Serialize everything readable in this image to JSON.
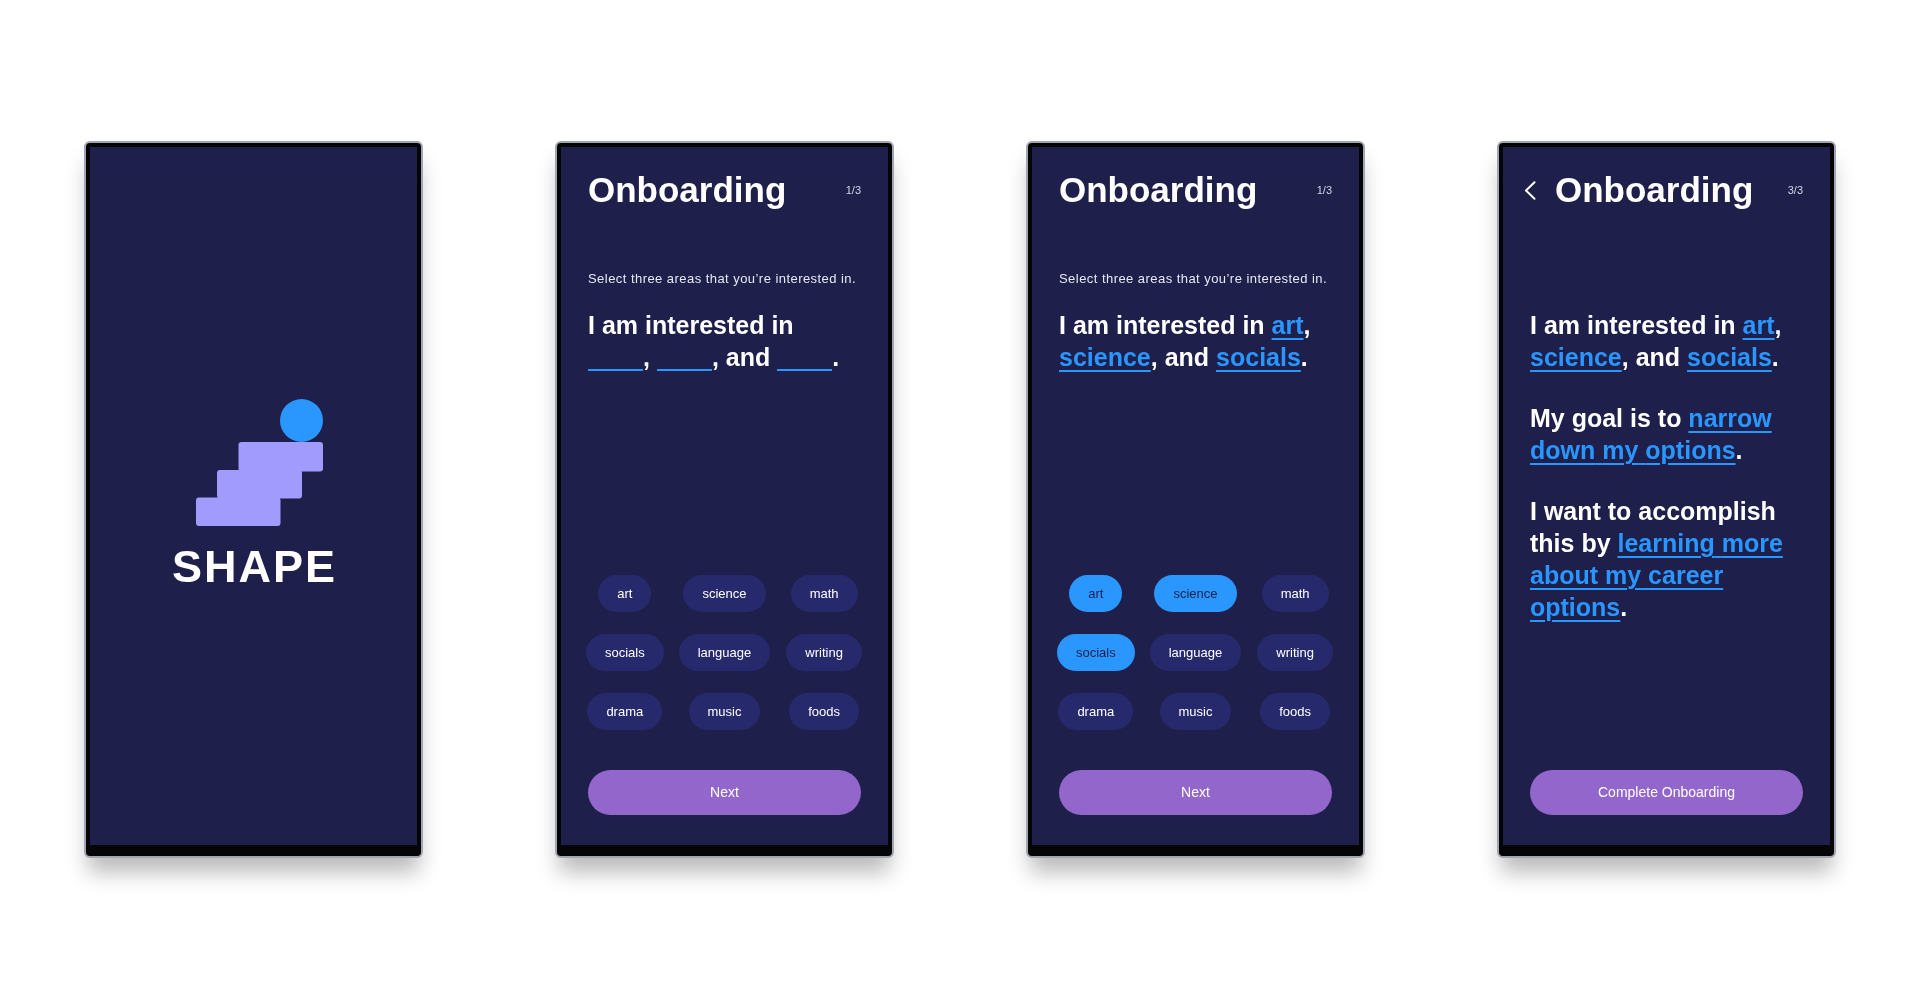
{
  "screens": [
    {
      "kind": "splash",
      "logo_text": "SHAPE"
    },
    {
      "kind": "onboarding",
      "back_button": false,
      "title": "Onboarding",
      "step": "1/3",
      "instruction": "Select three areas that you’re interested in.",
      "statements": [
        {
          "parts": [
            {
              "kind": "text",
              "text": "I am interested in "
            },
            {
              "kind": "blank"
            },
            {
              "kind": "text",
              "text": ", "
            },
            {
              "kind": "blank"
            },
            {
              "kind": "text",
              "text": ", and "
            },
            {
              "kind": "blank"
            },
            {
              "kind": "text",
              "text": "."
            }
          ]
        }
      ],
      "chips": [
        {
          "label": "art",
          "selected": false
        },
        {
          "label": "science",
          "selected": false
        },
        {
          "label": "math",
          "selected": false
        },
        {
          "label": "socials",
          "selected": false
        },
        {
          "label": "language",
          "selected": false
        },
        {
          "label": "writing",
          "selected": false
        },
        {
          "label": "drama",
          "selected": false
        },
        {
          "label": "music",
          "selected": false
        },
        {
          "label": "foods",
          "selected": false
        }
      ],
      "button": "Next"
    },
    {
      "kind": "onboarding",
      "back_button": false,
      "title": "Onboarding",
      "step": "1/3",
      "instruction": "Select three areas that you’re interested in.",
      "statements": [
        {
          "parts": [
            {
              "kind": "text",
              "text": "I am interested in "
            },
            {
              "kind": "answer",
              "text": "art"
            },
            {
              "kind": "text",
              "text": ", "
            },
            {
              "kind": "answer",
              "text": "science"
            },
            {
              "kind": "text",
              "text": ", and "
            },
            {
              "kind": "answer",
              "text": "socials"
            },
            {
              "kind": "text",
              "text": "."
            }
          ]
        }
      ],
      "chips": [
        {
          "label": "art",
          "selected": true
        },
        {
          "label": "science",
          "selected": true
        },
        {
          "label": "math",
          "selected": false
        },
        {
          "label": "socials",
          "selected": true
        },
        {
          "label": "language",
          "selected": false
        },
        {
          "label": "writing",
          "selected": false
        },
        {
          "label": "drama",
          "selected": false
        },
        {
          "label": "music",
          "selected": false
        },
        {
          "label": "foods",
          "selected": false
        }
      ],
      "button": "Next"
    },
    {
      "kind": "onboarding",
      "back_button": true,
      "title": "Onboarding",
      "step": "3/3",
      "statements": [
        {
          "parts": [
            {
              "kind": "text",
              "text": "I am interested in "
            },
            {
              "kind": "answer",
              "text": "art"
            },
            {
              "kind": "text",
              "text": ", "
            },
            {
              "kind": "answer",
              "text": "science"
            },
            {
              "kind": "text",
              "text": ", and "
            },
            {
              "kind": "answer",
              "text": "socials"
            },
            {
              "kind": "text",
              "text": "."
            }
          ]
        },
        {
          "parts": [
            {
              "kind": "text",
              "text": "My goal is to "
            },
            {
              "kind": "answer",
              "text": "narrow down my options"
            },
            {
              "kind": "text",
              "text": "."
            }
          ]
        },
        {
          "parts": [
            {
              "kind": "text",
              "text": "I want to accomplish this by "
            },
            {
              "kind": "answer",
              "text": "learning more about my career options"
            },
            {
              "kind": "text",
              "text": "."
            }
          ]
        }
      ],
      "button": "Complete Onboarding"
    }
  ]
}
